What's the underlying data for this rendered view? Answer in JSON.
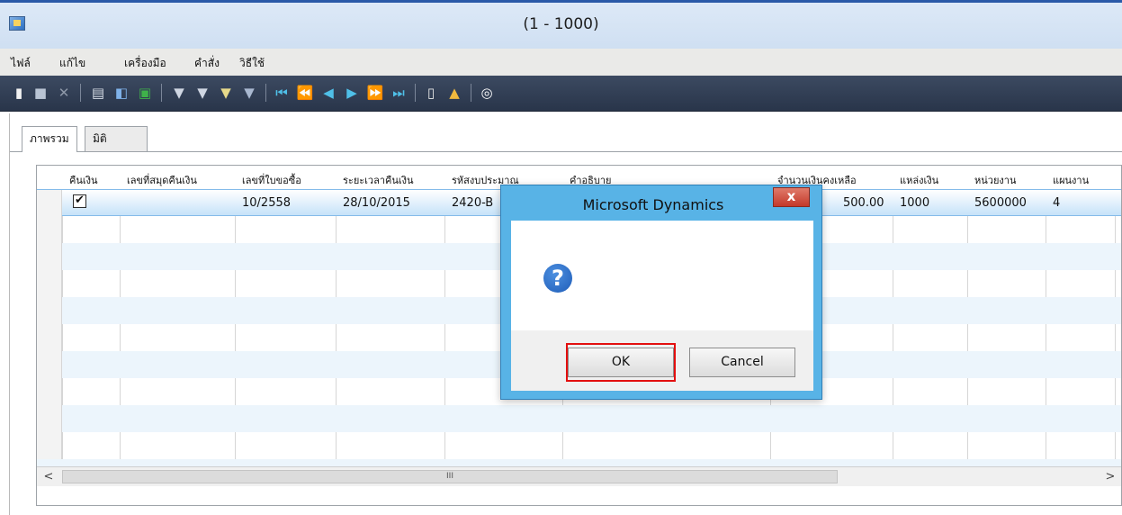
{
  "window": {
    "title": "(1 - 1000)"
  },
  "menu": [
    "ไฟล์",
    "แก้ไข",
    "เครื่องมือ",
    "คำสั่ง",
    "วิธีใช้"
  ],
  "tabs": {
    "overview": "ภาพรวม",
    "dimension": "มิติ"
  },
  "grid": {
    "headers": {
      "c1": "คืนเงิน",
      "c2": "เลขที่สมุดคืนเงิน",
      "c3": "เลขที่ใบขอซื้อ",
      "c4": "ระยะเวลาคืนเงิน",
      "c5": "รหัสงบประมาณ",
      "c6": "คำอธิบาย",
      "c7": "จำนวนเงินคงเหลือ",
      "c8": "แหล่งเงิน",
      "c9": "หน่วยงาน",
      "c10": "แผนงาน"
    },
    "row1": {
      "refund_checked": "✔",
      "pr_number": "10/2558",
      "period": "28/10/2015",
      "budget_code": "2420-B",
      "amount": "500.00",
      "fund": "1000",
      "unit": "5600000",
      "plan": "4"
    },
    "scroll_grip": "III"
  },
  "dialog": {
    "title": "Microsoft Dynamics",
    "close_glyph": "x",
    "icon_glyph": "?",
    "ok": "OK",
    "cancel": "Cancel"
  }
}
